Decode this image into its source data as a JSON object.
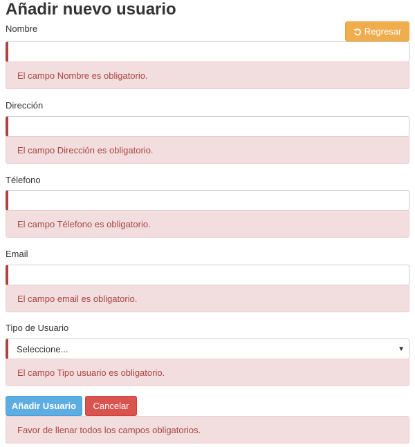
{
  "page": {
    "title": "Añadir nuevo usuario"
  },
  "header": {
    "back_button_label": "Regresar",
    "back_icon": "undo-icon"
  },
  "form": {
    "fields": [
      {
        "label": "Nombre",
        "value": "",
        "error": "El campo Nombre es obligatorio."
      },
      {
        "label": "Dirección",
        "value": "",
        "error": "El campo Dirección es obligatorio."
      },
      {
        "label": "Télefono",
        "value": "",
        "error": "El campo Télefono es obligatorio."
      },
      {
        "label": "Email",
        "value": "",
        "error": "El campo email es obligatorio."
      }
    ],
    "user_type": {
      "label": "Tipo de Usuario",
      "selected": "Seleccione...",
      "error": "El campo Tipo usuario es obligatorio."
    },
    "submit_label": "Añadir Usuario",
    "cancel_label": "Cancelar",
    "summary_error": "Favor de llenar todos los campos obligatorios."
  },
  "colors": {
    "error_text": "#a94442",
    "error_bg": "#f2dede",
    "warning": "#f0ad4e",
    "primary": "#5dade2",
    "danger": "#d9534f"
  }
}
